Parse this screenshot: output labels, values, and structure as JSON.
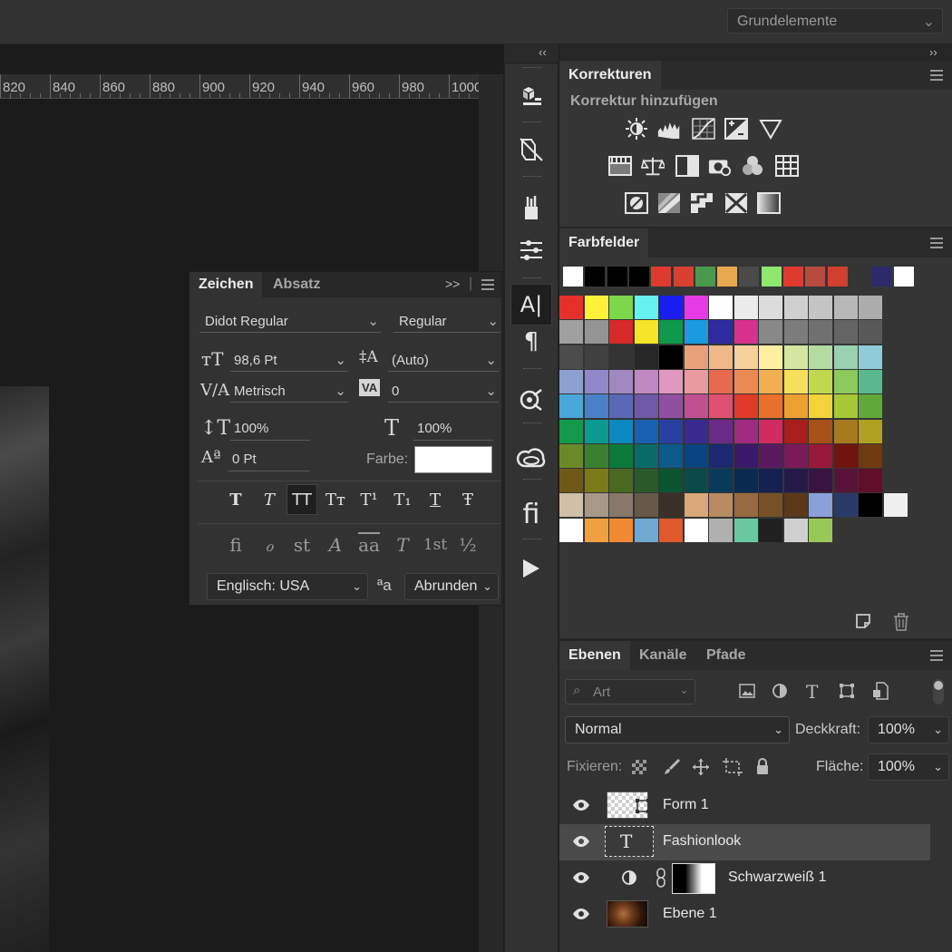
{
  "workspace": {
    "label": "Grundelemente"
  },
  "ruler": {
    "ticks": [
      "820",
      "840",
      "860",
      "880",
      "900",
      "920",
      "940",
      "960",
      "980",
      "1000"
    ]
  },
  "collapse": {
    "left": "‹‹",
    "right": "››"
  },
  "korrekturen": {
    "tab": "Korrekturen",
    "subtitle": "Korrektur hinzufügen"
  },
  "farbfelder": {
    "tab": "Farbfelder",
    "recent": [
      "#ffffff",
      "#000000",
      "#000000",
      "#000000",
      "#e03a2e",
      "#d94030",
      "#4a9a4e",
      "#e8a84e",
      "#4a4a4a",
      "#8ee86c",
      "#e03a2e",
      "#b84a3e",
      "#d0402e",
      "#353535",
      "#2c2a6a",
      "#ffffff"
    ],
    "grid": [
      [
        "#e8302a",
        "#fff13a",
        "#7bd84a",
        "#66f0ef",
        "#1a1ef0",
        "#e63ae6",
        "#ffffff",
        "#ebebeb",
        "#dcdcdc",
        "#d0d0d0",
        "#c4c4c4",
        "#b8b8b8",
        "#acacac"
      ],
      [
        "#a0a0a0",
        "#949494",
        "#d82a2a",
        "#f5e42a",
        "#0e9a4a",
        "#1a9ae0",
        "#2e2aa0",
        "#d8308c",
        "#888888",
        "#7c7c7c",
        "#707070",
        "#646464",
        "#585858"
      ],
      [
        "#4c4c4c",
        "#404040",
        "#333333",
        "#272727",
        "#000000",
        "#e8a07a",
        "#f0b888",
        "#f6d09a",
        "#fcf0a0",
        "#d4e6a0",
        "#b4dca0",
        "#98d0b0",
        "#90ccd8"
      ],
      [
        "#8ea0d0",
        "#9088c8",
        "#a088c0",
        "#c088c0",
        "#e098c0",
        "#e89aa0",
        "#e86a50",
        "#ea8a54",
        "#f0b050",
        "#f6e05a",
        "#c0d850",
        "#8cc85a",
        "#5ab890"
      ],
      [
        "#4aa8d8",
        "#4a80c8",
        "#5a68b8",
        "#7058a8",
        "#9050a0",
        "#c05090",
        "#e05070",
        "#e03a2a",
        "#e8702a",
        "#eca030",
        "#f2d43a",
        "#a8c838",
        "#60a838"
      ],
      [
        "#129a4a",
        "#0c9a90",
        "#0c88c0",
        "#1a60b0",
        "#2a40a0",
        "#3a2a90",
        "#6a2a88",
        "#a02a80",
        "#d02a60",
        "#a81e1a",
        "#a8501a",
        "#a87a1e",
        "#b0a020"
      ],
      [
        "#6a8a28",
        "#3a8030",
        "#0a7a3a",
        "#0a6a68",
        "#0a5a8a",
        "#0a4480",
        "#1a2a70",
        "#3a1a68",
        "#5a1a60",
        "#7a1a58",
        "#98183a",
        "#701410",
        "#703a10"
      ],
      [
        "#705818",
        "#7a7a18",
        "#486a20",
        "#2a5a2a",
        "#0a5430",
        "#0a4a48",
        "#0a3a5a",
        "#0a2a50",
        "#142050",
        "#241a4a",
        "#3a1440",
        "#581438",
        "#600e2a"
      ],
      [
        "#d0c0a8",
        "#a89888",
        "#887868",
        "#685848",
        "#3a3028",
        "#d8a878",
        "#b88a60",
        "#986a40",
        "#785028",
        "#5a3818",
        "#8aa0d8",
        "#2a3a68",
        "#000000",
        "#f0f0f0"
      ],
      [
        "#ffffff",
        "#f0a040",
        "#f08a30",
        "#70a8d0",
        "#e05a2a",
        "#ffffff",
        "#b0b0b0",
        "#6ac8a0",
        "#202020",
        "#d0d0d0",
        "#98c858"
      ]
    ]
  },
  "zeichen": {
    "tab_active": "Zeichen",
    "tab_other": "Absatz",
    "font_family": "Didot Regular",
    "font_style": "Regular",
    "size": "98,6 Pt",
    "leading": "(Auto)",
    "kerning": "Metrisch",
    "tracking": "0",
    "vscale": "100%",
    "hscale": "100%",
    "baseline": "0 Pt",
    "farbe_label": "Farbe:",
    "farbe_color": "#ffffff",
    "style_buttons": [
      "T",
      "T",
      "TT",
      "Tт",
      "T¹",
      "T₁",
      "T",
      "Ŧ"
    ],
    "opentype_buttons": [
      "ﬁ",
      "ℴ",
      "st",
      "A",
      "aa",
      "T",
      "1st",
      "½"
    ],
    "language": "Englisch: USA",
    "aa_icon": "ªa",
    "antialias": "Abrunden"
  },
  "ebenen": {
    "tabs": [
      "Ebenen",
      "Kanäle",
      "Pfade"
    ],
    "filter": "Art",
    "blend_mode": "Normal",
    "opacity_label": "Deckkraft:",
    "opacity": "100%",
    "lock_label": "Fixieren:",
    "fill_label": "Fläche:",
    "fill": "100%",
    "layers": [
      {
        "name": "Form 1"
      },
      {
        "name": "Fashionlook"
      },
      {
        "name": "Schwarzweiß 1"
      },
      {
        "name": "Ebene 1"
      }
    ]
  }
}
